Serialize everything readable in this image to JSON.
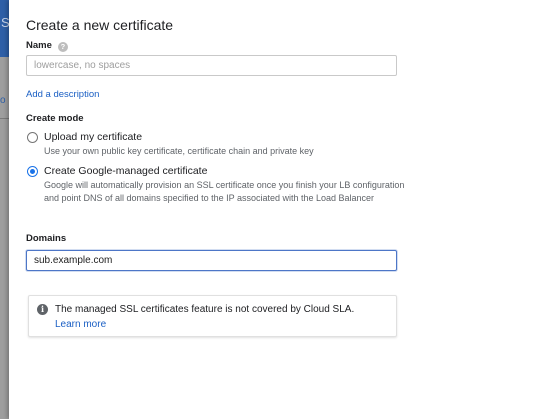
{
  "dialog": {
    "title": "Create a new certificate"
  },
  "name_field": {
    "label": "Name",
    "help_icon": "help-circle-icon",
    "placeholder": "lowercase, no spaces",
    "value": ""
  },
  "add_description_link": "Add a description",
  "create_mode": {
    "label": "Create mode",
    "options": [
      {
        "label": "Upload my certificate",
        "description": "Use your own public key certificate, certificate chain and private key",
        "selected": false
      },
      {
        "label": "Create Google-managed certificate",
        "description": "Google will automatically provision an SSL certificate once you finish your LB configuration and point DNS of all domains specified to the IP associated with the Load Balancer",
        "selected": true
      }
    ]
  },
  "domains_field": {
    "label": "Domains",
    "value": "sub.example.com"
  },
  "notice": {
    "icon": "info-icon",
    "text": "The managed SSL certificates feature is not covered by Cloud SLA.",
    "link": "Learn more"
  },
  "colors": {
    "accent": "#1a73e8",
    "link": "#1a5fc4",
    "header_bar": "#2e5fa7"
  }
}
